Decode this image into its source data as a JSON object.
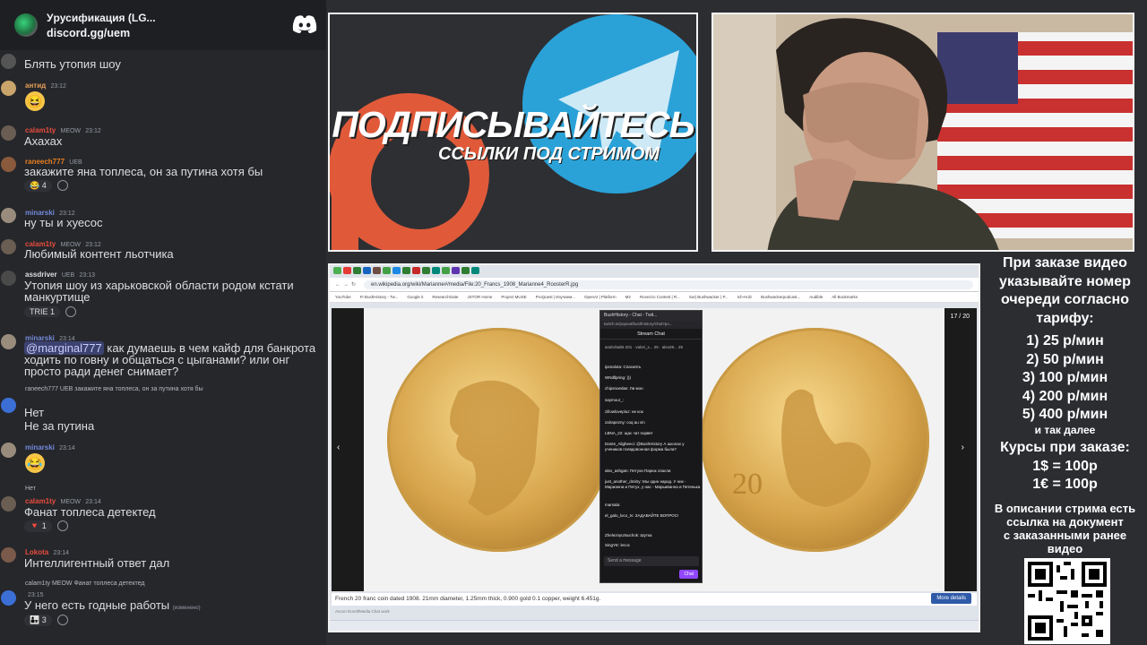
{
  "server": {
    "name": "Уpусификация (LG...",
    "invite": "discord.gg/uem"
  },
  "messages": [
    {
      "user": "",
      "text": "Блять утопия шоу"
    },
    {
      "user": "антид",
      "time": "23:12"
    },
    {
      "user": "calam1ty",
      "tag": "MEOW",
      "time": "23:12",
      "text": "Ахахах"
    },
    {
      "user": "raneech777",
      "tag": "UEB",
      "time": "23:12",
      "text": "закажите яна топлеса, он за путина хотя бы",
      "reaction": "4"
    },
    {
      "user": "minarski",
      "time": "23:12",
      "text": "ну ты и хуесос"
    },
    {
      "user": "calam1ty",
      "tag": "MEOW",
      "time": "23:12",
      "text": "Любимый контент льотчика"
    },
    {
      "user": "assdriver",
      "tag": "UEB",
      "time": "23:13",
      "text": "Утопия шоу из харьковской области родом кстати манкуртище",
      "reaction": "1"
    },
    {
      "user": "minarski",
      "time": "23:14",
      "mention": "@marginal777",
      "text": "как думаешь в чем кайф для банкрота ходить по говну и общаться с цыганами? или онг просто ради денег снимает?"
    },
    {
      "reply": "raneech777 UEB закажите яна топлеса, он за путина хотя бы",
      "text1": "Нет",
      "text2": "Не за путина"
    },
    {
      "user": "minarski",
      "time": "23:14"
    },
    {
      "reply": "Нет",
      "user": "calam1ty",
      "tag": "MEOW",
      "time": "23:14",
      "text": "Фанат топлеса детектед",
      "reaction": "1"
    },
    {
      "user": "Lokota",
      "time": "23:14",
      "text": "Интеллигентный ответ дал"
    },
    {
      "reply": "calam1ty MEOW Фанат топлеса детектед",
      "time": "23:15",
      "text": "У него есть годные работы",
      "edited": "(изменено)",
      "reaction": "3"
    }
  ],
  "promo": {
    "title": "ПОДПИСЫВАЙТЕСЬ",
    "subtitle": "ССЫЛКИ ПОД СТРИМОМ"
  },
  "browser": {
    "address": "en.wikipedia.org/wiki/Marianne#/media/File:20_Francs_1908_Marianne4_RoosterR.jpg",
    "bookmarks": [
      "YouTube",
      "FI BushHistory - Tw...",
      "Google it",
      "ResearchGate",
      "JSTOR Home",
      "Project MUSE",
      "ProQuest | Изучаем...",
      "OpenAI | Platform",
      "M2",
      "Rovezzo Contest | R...",
      "Sor| Bushwacker | P...",
      "Ich-Holz",
      "Bushwackerpodcast...",
      "Audible",
      "All Bookmarks"
    ],
    "counter": "17 / 20",
    "caption": "French 20 franc coin dated 1908. 21mm diameter, 1.25mm thick, 0.900 gold 0.1 copper, weight 6.451g.",
    "more": "More details",
    "author": "Ancori Dorell/Media Chat work"
  },
  "popup": {
    "bar": "BushHistory - Chat - Twit...",
    "url": "twitch.tv/popout/bushhistory/chat?po...",
    "header": "Stream Chat",
    "lines": [
      "androhab5 201 · valori_x... 25 · alex29... 25",
      "ipsnalota: Спасипть",
      "WNdllpring: )))",
      "chipsnoedas: Ли мон",
      "saymour_: ",
      "zillowlovepluz: не кок",
      "zalrapezny: coq au vin",
      "LBNA_22: щас чат порвет",
      "Dante_Aligheeci: @BushHistory А школах у учеников псевдовонная форма была?",
      "alex_ashgan: Петухи Парюк спасли",
      "just_another_dmitry: Мы один народ. У них - Марианна и Петух, у нас - Марьиванна и Петенька",
      "marsala: ",
      "el_galo_loco_tv: ЗАДАВАЙТЕ ВОПРОС!",
      "ZheleznyUtsuchok: Шутка",
      "SingYE: lecoc"
    ],
    "send": "Send a message",
    "chat": "Chat"
  },
  "info": {
    "intro": [
      "При заказе видео",
      "указывайте номер",
      "очереди согласно",
      "тарифу:"
    ],
    "tariffs": [
      "1) 25 р/мин",
      "2) 50 р/мин",
      "3) 100 р/мин",
      "4) 200 р/мин",
      "5) 400 р/мин"
    ],
    "etc": "и так далее",
    "rates_title": "Курсы при заказе:",
    "rates": [
      "1$ = 100р",
      "1€ = 100р"
    ],
    "desc": [
      "В описании стрима есть",
      "ссылка на документ",
      "с заказанными ранее",
      "видео"
    ]
  }
}
